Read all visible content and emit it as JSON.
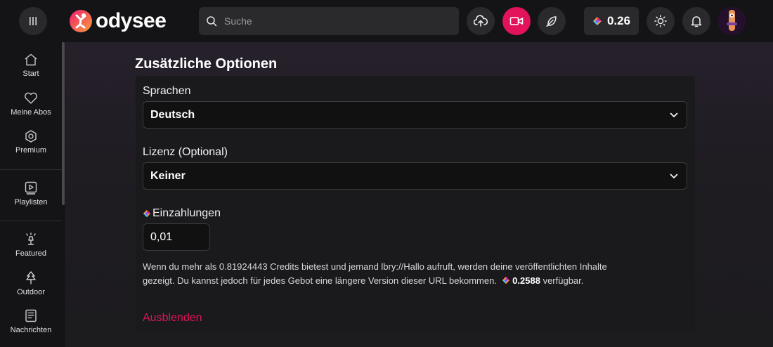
{
  "header": {
    "logo_text": "odysee",
    "search_placeholder": "Suche",
    "credits_balance": "0.26"
  },
  "sidebar": {
    "items": [
      {
        "label": "Start",
        "icon": "home-icon"
      },
      {
        "label": "Meine Abos",
        "icon": "heart-icon"
      },
      {
        "label": "Premium",
        "icon": "premium-icon"
      },
      {
        "label": "Playlisten",
        "icon": "playlist-icon"
      },
      {
        "label": "Featured",
        "icon": "featured-icon"
      },
      {
        "label": "Outdoor",
        "icon": "tree-icon"
      },
      {
        "label": "Nachrichten",
        "icon": "news-icon"
      }
    ]
  },
  "main": {
    "section_title": "Zusätzliche Optionen",
    "language_label": "Sprachen",
    "language_value": "Deutsch",
    "license_label": "Lizenz (Optional)",
    "license_value": "Keiner",
    "deposit_label": "Einzahlungen",
    "deposit_value": "0,01",
    "help_line1": "Wenn du mehr als 0.81924443 Credits bietest und jemand lbry://Hallo aufruft, werden deine veröffentlichten Inhalte",
    "help_line2_prefix": "gezeigt. Du kannst jedoch für jedes Gebot eine längere Version dieser URL bekommen.",
    "help_available_amount": "0.2588",
    "help_available_suffix": "verfügbar.",
    "hide_link": "Ausblenden"
  },
  "colors": {
    "accent": "#e2135a",
    "background": "#1a1a1c"
  }
}
